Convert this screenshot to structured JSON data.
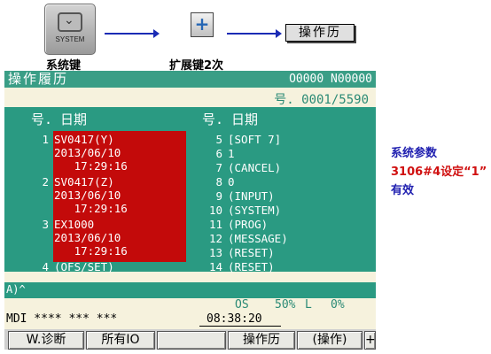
{
  "top": {
    "system_key_text": "SYSTEM",
    "system_key_caption": "系统键",
    "extend_key_symbol": "+",
    "extend_key_caption": "扩展键2次",
    "history_button": "操作历"
  },
  "screen": {
    "title": "操作履历",
    "program_numbers": "O0000 N00000",
    "page_indicator": "号. 0001/5590",
    "left_header": "号. 日期",
    "right_header": "号. 日期",
    "left_entries": [
      {
        "no": "1",
        "lines": [
          "SV0417(Y)",
          "2013/06/10",
          "   17:29:16"
        ]
      },
      {
        "no": "2",
        "lines": [
          "SV0417(Z)",
          "2013/06/10",
          "   17:29:16"
        ]
      },
      {
        "no": "3",
        "lines": [
          "EX1000",
          "2013/06/10",
          "   17:29:16"
        ]
      },
      {
        "no": "4",
        "lines": [
          "(OFS/SET)"
        ]
      }
    ],
    "right_entries": [
      {
        "no": "5",
        "text": "[SOFT 7]"
      },
      {
        "no": "6",
        "text": "1"
      },
      {
        "no": "7",
        "text": "(CANCEL)"
      },
      {
        "no": "8",
        "text": "0"
      },
      {
        "no": "9",
        "text": "(INPUT)"
      },
      {
        "no": "10",
        "text": "(SYSTEM)"
      },
      {
        "no": "11",
        "text": "(PROG)"
      },
      {
        "no": "12",
        "text": "(MESSAGE)"
      },
      {
        "no": "13",
        "text": "(RESET)"
      },
      {
        "no": "14",
        "text": "(RESET)"
      }
    ],
    "input_prompt": "A)^",
    "os_label": "OS",
    "os_value": "50%",
    "l_label": "L",
    "l_value": "0%",
    "mode_status": "MDI  **** *** ***",
    "clock": "08:38:20",
    "softkeys": [
      "W.诊断",
      "所有IO",
      "",
      "操作历",
      "(操作)",
      "+"
    ]
  },
  "note": {
    "line1": "系统参数",
    "line2": "3106#4设定“1”",
    "line3": "有效"
  },
  "colors": {
    "screen_bg": "#f6f2dd",
    "panel_teal": "#2a9a82",
    "alarm_red": "#c30a0a",
    "arrow_blue": "#1a2bb5",
    "note_blue": "#2020b0",
    "note_red": "#d01010"
  }
}
